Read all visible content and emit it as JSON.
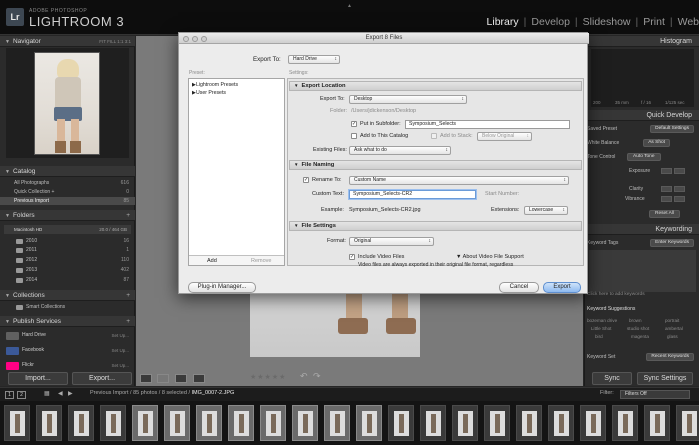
{
  "branding": {
    "vendor": "ADOBE PHOTOSHOP",
    "product": "LIGHTROOM 3",
    "badge": "Lr"
  },
  "modules": [
    {
      "label": "Library",
      "active": true
    },
    {
      "label": "Develop"
    },
    {
      "label": "Slideshow"
    },
    {
      "label": "Print"
    },
    {
      "label": "Web"
    }
  ],
  "left_panel": {
    "navigator": {
      "title": "Navigator",
      "options": "FIT  FILL  1:1  3:1"
    },
    "catalog": {
      "title": "Catalog",
      "items": [
        {
          "label": "All Photographs",
          "count": "616"
        },
        {
          "label": "Quick Collection +",
          "count": "0"
        },
        {
          "label": "Previous Import",
          "count": "85"
        }
      ]
    },
    "folders": {
      "title": "Folders",
      "disk": {
        "label": "Macintosh HD",
        "count": "20.0 / 464 GB"
      },
      "items": [
        {
          "label": "2010",
          "count": "16"
        },
        {
          "label": "2011",
          "count": "1"
        },
        {
          "label": "2012",
          "count": "110"
        },
        {
          "label": "2013",
          "count": "402"
        },
        {
          "label": "2014",
          "count": "87"
        }
      ]
    },
    "collections": {
      "title": "Collections",
      "smart": "Smart Collections"
    },
    "publish": {
      "title": "Publish Services",
      "items": [
        {
          "label": "Hard Drive",
          "action": "Set Up..."
        },
        {
          "label": "Facebook",
          "action": "Set Up..."
        },
        {
          "label": "Flickr",
          "action": "Set Up..."
        }
      ]
    },
    "import_label": "Import...",
    "export_label": "Export..."
  },
  "right_panel": {
    "histogram": {
      "title": "Histogram",
      "readout": [
        "200",
        "35 mm",
        "f / 16",
        "1/125 sec"
      ]
    },
    "quick_develop": {
      "title": "Quick Develop",
      "saved_preset_label": "Saved Preset",
      "saved_preset_value": "Default Settings",
      "white_balance_label": "White Balance",
      "white_balance_value": "As Shot",
      "tone_control_label": "Tone Control",
      "auto_tone_label": "Auto Tone",
      "exposure_label": "Exposure",
      "clarity_label": "Clarity",
      "vibrance_label": "Vibrance",
      "reset_label": "Reset All"
    },
    "keywording": {
      "title": "Keywording",
      "tags_label": "Keyword Tags",
      "tags_value": "Enter Keywords",
      "hint": "Click here to add keywords",
      "suggestions_title": "Keyword Suggestions",
      "suggestions": [
        "bozeman drive",
        "brown",
        "portrait",
        "Little Shot",
        "studio shot",
        "ambertal",
        "bird",
        "magenta",
        "glass"
      ],
      "set_label": "Keyword Set",
      "set_value": "Recent Keywords"
    },
    "sync_label": "Sync",
    "sync_settings_label": "Sync Settings"
  },
  "filmstrip": {
    "page_numbers": [
      "1",
      "2"
    ],
    "path": "Previous Import / 85 photos / 8 selected /",
    "current_file": "IMG_0007-2.JPG",
    "filter_label": "Filter:",
    "filter_value": "Filters Off",
    "selected_count": 8
  },
  "dialog": {
    "title": "Export 8 Files",
    "export_to_label": "Export To:",
    "export_to_value": "Hard Drive",
    "preset_header": "Preset:",
    "settings_header": "Settings:",
    "presets": [
      "Lightroom Presets",
      "User Presets"
    ],
    "add_label": "Add",
    "remove_label": "Remove",
    "plugin_manager_label": "Plug-in Manager...",
    "cancel_label": "Cancel",
    "export_label": "Export",
    "location": {
      "title": "Export Location",
      "export_to_label": "Export To:",
      "export_to_value": "Desktop",
      "folder_label": "Folder:",
      "folder_value": "/Users/jdickenson/Desktop",
      "subfolder_label": "Put in Subfolder:",
      "subfolder_value": "Symposium_Selects",
      "add_catalog_label": "Add to This Catalog",
      "add_stack_label": "Add to Stack:",
      "stack_value": "Below Original",
      "existing_label": "Existing Files:",
      "existing_value": "Ask what to do"
    },
    "naming": {
      "title": "File Naming",
      "rename_label": "Rename To:",
      "rename_value": "Custom Name",
      "custom_text_label": "Custom Text:",
      "custom_text_value": "Symposium_Selects-CR2",
      "start_number_label": "Start Number:",
      "example_label": "Example:",
      "example_value": "Symposium_Selects-CR2.jpg",
      "extensions_label": "Extensions:",
      "extensions_value": "Lowercase"
    },
    "file_settings": {
      "title": "File Settings",
      "format_label": "Format:",
      "format_value": "Original",
      "include_video_label": "Include Video Files",
      "about_video_label": "About Video File Support",
      "note": "Video files are always exported in their original file format, regardless"
    }
  }
}
